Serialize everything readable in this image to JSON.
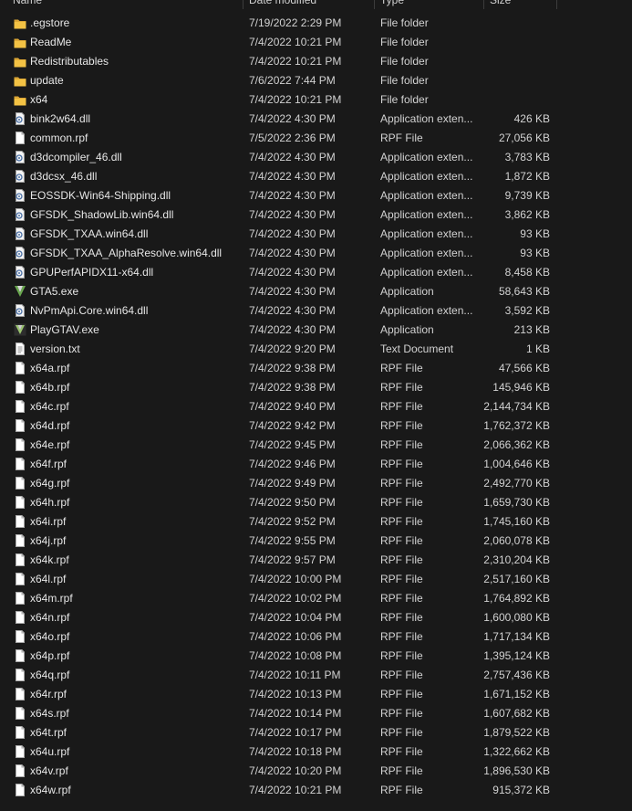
{
  "header": {
    "name_label": "Name",
    "date_label": "Date modified",
    "type_label": "Type",
    "size_label": "Size"
  },
  "colors": {
    "background": "#191919",
    "text": "#e6e6e6",
    "folder": "#f3c244"
  },
  "files": [
    {
      "name": ".egstore",
      "date": "7/19/2022 2:29 PM",
      "type": "File folder",
      "size": "",
      "icon": "folder-icon"
    },
    {
      "name": "ReadMe",
      "date": "7/4/2022 10:21 PM",
      "type": "File folder",
      "size": "",
      "icon": "folder-icon"
    },
    {
      "name": "Redistributables",
      "date": "7/4/2022 10:21 PM",
      "type": "File folder",
      "size": "",
      "icon": "folder-icon"
    },
    {
      "name": "update",
      "date": "7/6/2022 7:44 PM",
      "type": "File folder",
      "size": "",
      "icon": "folder-icon"
    },
    {
      "name": "x64",
      "date": "7/4/2022 10:21 PM",
      "type": "File folder",
      "size": "",
      "icon": "folder-icon"
    },
    {
      "name": "bink2w64.dll",
      "date": "7/4/2022 4:30 PM",
      "type": "Application exten...",
      "size": "426 KB",
      "icon": "dll-icon"
    },
    {
      "name": "common.rpf",
      "date": "7/5/2022 2:36 PM",
      "type": "RPF File",
      "size": "27,056 KB",
      "icon": "file-icon"
    },
    {
      "name": "d3dcompiler_46.dll",
      "date": "7/4/2022 4:30 PM",
      "type": "Application exten...",
      "size": "3,783 KB",
      "icon": "dll-icon"
    },
    {
      "name": "d3dcsx_46.dll",
      "date": "7/4/2022 4:30 PM",
      "type": "Application exten...",
      "size": "1,872 KB",
      "icon": "dll-icon"
    },
    {
      "name": "EOSSDK-Win64-Shipping.dll",
      "date": "7/4/2022 4:30 PM",
      "type": "Application exten...",
      "size": "9,739 KB",
      "icon": "dll-icon"
    },
    {
      "name": "GFSDK_ShadowLib.win64.dll",
      "date": "7/4/2022 4:30 PM",
      "type": "Application exten...",
      "size": "3,862 KB",
      "icon": "dll-icon"
    },
    {
      "name": "GFSDK_TXAA.win64.dll",
      "date": "7/4/2022 4:30 PM",
      "type": "Application exten...",
      "size": "93 KB",
      "icon": "dll-icon"
    },
    {
      "name": "GFSDK_TXAA_AlphaResolve.win64.dll",
      "date": "7/4/2022 4:30 PM",
      "type": "Application exten...",
      "size": "93 KB",
      "icon": "dll-icon"
    },
    {
      "name": "GPUPerfAPIDX11-x64.dll",
      "date": "7/4/2022 4:30 PM",
      "type": "Application exten...",
      "size": "8,458 KB",
      "icon": "dll-icon"
    },
    {
      "name": "GTA5.exe",
      "date": "7/4/2022 4:30 PM",
      "type": "Application",
      "size": "58,643 KB",
      "icon": "gta5-app-icon"
    },
    {
      "name": "NvPmApi.Core.win64.dll",
      "date": "7/4/2022 4:30 PM",
      "type": "Application exten...",
      "size": "3,592 KB",
      "icon": "dll-icon"
    },
    {
      "name": "PlayGTAV.exe",
      "date": "7/4/2022 4:30 PM",
      "type": "Application",
      "size": "213 KB",
      "icon": "gtav-launcher-icon"
    },
    {
      "name": "version.txt",
      "date": "7/4/2022 9:20 PM",
      "type": "Text Document",
      "size": "1 KB",
      "icon": "text-file-icon"
    },
    {
      "name": "x64a.rpf",
      "date": "7/4/2022 9:38 PM",
      "type": "RPF File",
      "size": "47,566 KB",
      "icon": "file-icon"
    },
    {
      "name": "x64b.rpf",
      "date": "7/4/2022 9:38 PM",
      "type": "RPF File",
      "size": "145,946 KB",
      "icon": "file-icon"
    },
    {
      "name": "x64c.rpf",
      "date": "7/4/2022 9:40 PM",
      "type": "RPF File",
      "size": "2,144,734 KB",
      "icon": "file-icon"
    },
    {
      "name": "x64d.rpf",
      "date": "7/4/2022 9:42 PM",
      "type": "RPF File",
      "size": "1,762,372 KB",
      "icon": "file-icon"
    },
    {
      "name": "x64e.rpf",
      "date": "7/4/2022 9:45 PM",
      "type": "RPF File",
      "size": "2,066,362 KB",
      "icon": "file-icon"
    },
    {
      "name": "x64f.rpf",
      "date": "7/4/2022 9:46 PM",
      "type": "RPF File",
      "size": "1,004,646 KB",
      "icon": "file-icon"
    },
    {
      "name": "x64g.rpf",
      "date": "7/4/2022 9:49 PM",
      "type": "RPF File",
      "size": "2,492,770 KB",
      "icon": "file-icon"
    },
    {
      "name": "x64h.rpf",
      "date": "7/4/2022 9:50 PM",
      "type": "RPF File",
      "size": "1,659,730 KB",
      "icon": "file-icon"
    },
    {
      "name": "x64i.rpf",
      "date": "7/4/2022 9:52 PM",
      "type": "RPF File",
      "size": "1,745,160 KB",
      "icon": "file-icon"
    },
    {
      "name": "x64j.rpf",
      "date": "7/4/2022 9:55 PM",
      "type": "RPF File",
      "size": "2,060,078 KB",
      "icon": "file-icon"
    },
    {
      "name": "x64k.rpf",
      "date": "7/4/2022 9:57 PM",
      "type": "RPF File",
      "size": "2,310,204 KB",
      "icon": "file-icon"
    },
    {
      "name": "x64l.rpf",
      "date": "7/4/2022 10:00 PM",
      "type": "RPF File",
      "size": "2,517,160 KB",
      "icon": "file-icon"
    },
    {
      "name": "x64m.rpf",
      "date": "7/4/2022 10:02 PM",
      "type": "RPF File",
      "size": "1,764,892 KB",
      "icon": "file-icon"
    },
    {
      "name": "x64n.rpf",
      "date": "7/4/2022 10:04 PM",
      "type": "RPF File",
      "size": "1,600,080 KB",
      "icon": "file-icon"
    },
    {
      "name": "x64o.rpf",
      "date": "7/4/2022 10:06 PM",
      "type": "RPF File",
      "size": "1,717,134 KB",
      "icon": "file-icon"
    },
    {
      "name": "x64p.rpf",
      "date": "7/4/2022 10:08 PM",
      "type": "RPF File",
      "size": "1,395,124 KB",
      "icon": "file-icon"
    },
    {
      "name": "x64q.rpf",
      "date": "7/4/2022 10:11 PM",
      "type": "RPF File",
      "size": "2,757,436 KB",
      "icon": "file-icon"
    },
    {
      "name": "x64r.rpf",
      "date": "7/4/2022 10:13 PM",
      "type": "RPF File",
      "size": "1,671,152 KB",
      "icon": "file-icon"
    },
    {
      "name": "x64s.rpf",
      "date": "7/4/2022 10:14 PM",
      "type": "RPF File",
      "size": "1,607,682 KB",
      "icon": "file-icon"
    },
    {
      "name": "x64t.rpf",
      "date": "7/4/2022 10:17 PM",
      "type": "RPF File",
      "size": "1,879,522 KB",
      "icon": "file-icon"
    },
    {
      "name": "x64u.rpf",
      "date": "7/4/2022 10:18 PM",
      "type": "RPF File",
      "size": "1,322,662 KB",
      "icon": "file-icon"
    },
    {
      "name": "x64v.rpf",
      "date": "7/4/2022 10:20 PM",
      "type": "RPF File",
      "size": "1,896,530 KB",
      "icon": "file-icon"
    },
    {
      "name": "x64w.rpf",
      "date": "7/4/2022 10:21 PM",
      "type": "RPF File",
      "size": "915,372 KB",
      "icon": "file-icon"
    }
  ]
}
